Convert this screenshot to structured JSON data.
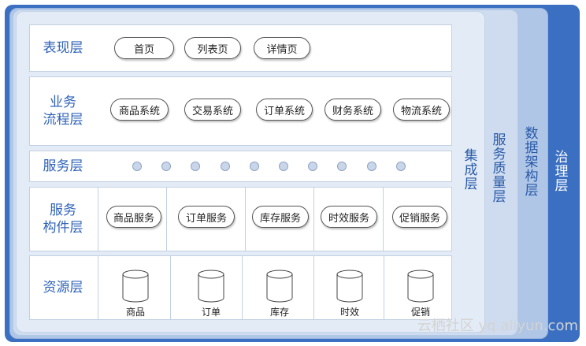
{
  "outer_layers": {
    "governance": "治理层",
    "data_architecture": "数据架构层",
    "service_quality": "服务质量层",
    "integration": "集成层"
  },
  "rows": {
    "presentation": {
      "label": "表现层",
      "items": [
        "首页",
        "列表页",
        "详情页"
      ]
    },
    "business_process": {
      "label_line1": "业务",
      "label_line2": "流程层",
      "items": [
        "商品系统",
        "交易系统",
        "订单系统",
        "财务系统",
        "物流系统"
      ]
    },
    "service": {
      "label": "服务层",
      "node_count": 10
    },
    "service_component": {
      "label_line1": "服务",
      "label_line2": "构件层",
      "items": [
        "商品服务",
        "订单服务",
        "库存服务",
        "时效服务",
        "促销服务"
      ]
    },
    "resource": {
      "label": "资源层",
      "items": [
        "商品",
        "订单",
        "库存",
        "时效",
        "促销"
      ]
    }
  },
  "watermark": "云栖社区 yq.aliyun.com"
}
